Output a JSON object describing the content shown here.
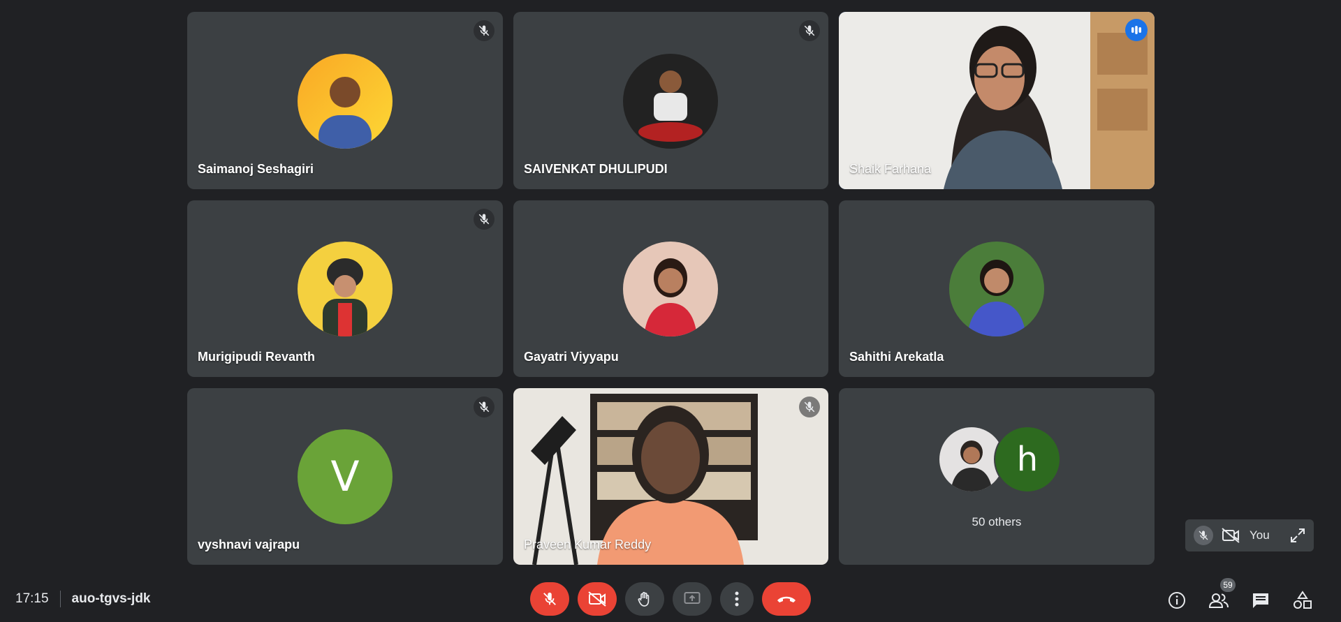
{
  "meeting": {
    "time": "17:15",
    "code": "auo-tgvs-jdk"
  },
  "participants": [
    {
      "name": "Saimanoj Seshagiri",
      "muted": true,
      "avatar_bg": "#fbbc04"
    },
    {
      "name": "SAIVENKAT DHULIPUDI",
      "muted": true,
      "avatar_bg": "#1e1e1e"
    },
    {
      "name": "Shaik Farhana",
      "muted": false,
      "speaking": true
    },
    {
      "name": "Murigipudi Revanth",
      "muted": true,
      "avatar_bg": "#f4d03f"
    },
    {
      "name": "Gayatri Viyyapu",
      "muted": false,
      "avatar_bg": "#e6c7b8"
    },
    {
      "name": "Sahithi Arekatla",
      "muted": false,
      "avatar_bg": "#4b7d3a"
    },
    {
      "name": "vyshnavi vajrapu",
      "muted": true,
      "avatar_letter": "V",
      "avatar_bg": "#6aa338"
    },
    {
      "name": "Praveen Kumar Reddy",
      "muted": true,
      "video": true
    }
  ],
  "others": {
    "label": "50 others",
    "avatar_letter": "h",
    "avatar_bg": "#2d6a1f"
  },
  "self_view": {
    "label": "You"
  },
  "people_count": "59",
  "colors": {
    "background": "#202124",
    "tile": "#3c4043",
    "speaking_outline": "#669df6",
    "danger": "#ea4335"
  },
  "controls": [
    "mic-off-icon",
    "camera-off-icon",
    "raise-hand-icon",
    "present-icon",
    "more-options-icon",
    "hang-up-icon"
  ],
  "right_controls": [
    "info-icon",
    "people-icon",
    "chat-icon",
    "activities-icon"
  ]
}
